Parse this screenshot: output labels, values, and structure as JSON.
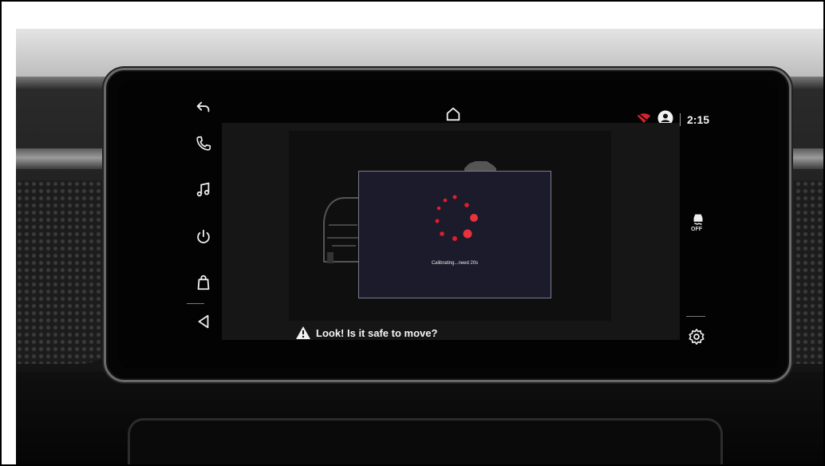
{
  "status_bar": {
    "time": "2:15",
    "signal_icon": "wifi-off-icon",
    "profile_icon": "user-avatar-icon"
  },
  "nav": {
    "home_icon": "home-icon",
    "left_items": [
      {
        "name": "back-icon"
      },
      {
        "name": "phone-icon"
      },
      {
        "name": "music-icon"
      },
      {
        "name": "power-icon"
      },
      {
        "name": "shopping-bag-icon"
      },
      {
        "name": "volume-icon"
      }
    ],
    "right_items": [
      {
        "name": "traction-control-off-icon",
        "label": "OFF"
      },
      {
        "name": "settings-gear-icon"
      }
    ]
  },
  "calibration": {
    "status_text": "Calibrating...need 20s",
    "spinner_color": "#e01f2a"
  },
  "warning": {
    "text": "Look! Is it safe to move?",
    "icon": "warning-triangle-icon"
  }
}
